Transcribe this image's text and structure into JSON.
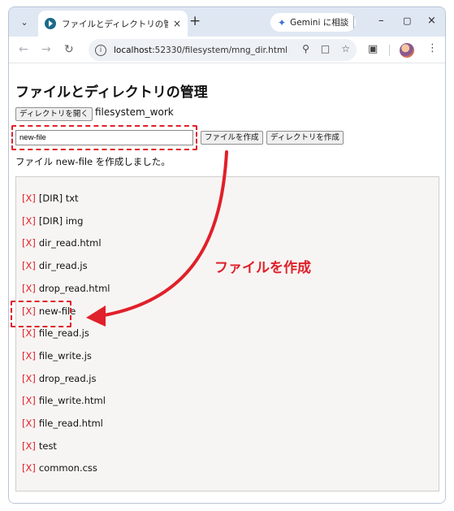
{
  "browser": {
    "tab_title": "ファイルとディレクトリの管理",
    "tab_close": "×",
    "new_tab": "+",
    "gemini_label": "Gemini に相談",
    "url_host": "localhost",
    "url_rest": ":52330/filesystem/mng_dir.html",
    "window_controls": [
      "–",
      "▢",
      "×"
    ],
    "icons": [
      "chevron-down-icon",
      "favicon-icon",
      "close-icon",
      "plus-icon",
      "back-icon",
      "forward-icon",
      "reload-icon",
      "site-info-icon",
      "zoom-icon",
      "page-icon",
      "star-icon",
      "extensions-icon",
      "avatar",
      "menu-icon"
    ]
  },
  "page": {
    "title": "ファイルとディレクトリの管理",
    "open_dir_button": "ディレクトリを開く",
    "dir_name": "filesystem_work",
    "name_input_value": "new-file",
    "create_file_button": "ファイルを作成",
    "create_dir_button": "ディレクトリを作成",
    "status_message": "ファイル new-file を作成しました。",
    "delete_marker": "[X]",
    "entries": [
      "[DIR] txt",
      "[DIR] img",
      "dir_read.html",
      "dir_read.js",
      "drop_read.html",
      "new-file",
      "file_read.js",
      "file_write.js",
      "drop_read.js",
      "file_write.html",
      "file_read.html",
      "test",
      "common.css"
    ],
    "highlighted_entry_index": 5
  },
  "annotation": {
    "label": "ファイルを作成",
    "color": "#e0202a"
  }
}
